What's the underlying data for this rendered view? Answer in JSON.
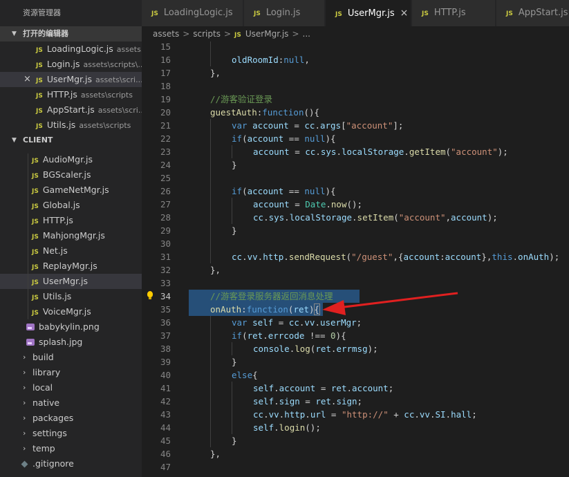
{
  "sidebar": {
    "title": "资源管理器",
    "open_editors_header": "打开的编辑器",
    "open_editors": [
      {
        "name": "LoadingLogic.js",
        "path": "assets..."
      },
      {
        "name": "Login.js",
        "path": "assets\\scripts\\..."
      },
      {
        "name": "UserMgr.js",
        "path": "assets\\scri...",
        "active": true
      },
      {
        "name": "HTTP.js",
        "path": "assets\\scripts"
      },
      {
        "name": "AppStart.js",
        "path": "assets\\scri..."
      },
      {
        "name": "Utils.js",
        "path": "assets\\scripts"
      }
    ],
    "client_header": "CLIENT",
    "client_files": [
      "AudioMgr.js",
      "BGScaler.js",
      "GameNetMgr.js",
      "Global.js",
      "HTTP.js",
      "MahjongMgr.js",
      "Net.js",
      "ReplayMgr.js",
      "UserMgr.js",
      "Utils.js",
      "VoiceMgr.js"
    ],
    "images": [
      "babykylin.png",
      "splash.jpg"
    ],
    "folders": [
      "build",
      "library",
      "local",
      "native",
      "packages",
      "settings",
      "temp"
    ],
    "dotfile": ".gitignore"
  },
  "tabs": [
    {
      "label": "LoadingLogic.js"
    },
    {
      "label": "Login.js"
    },
    {
      "label": "UserMgr.js",
      "active": true
    },
    {
      "label": "HTTP.js"
    },
    {
      "label": "AppStart.js"
    }
  ],
  "js_badge": "JS",
  "close_glyph": "×",
  "breadcrumb": {
    "parts": [
      "assets",
      "scripts",
      "UserMgr.js",
      "..."
    ],
    "separator": ">"
  },
  "editor": {
    "current_line": 34,
    "highlight_lines": [
      34,
      35
    ],
    "lines": [
      {
        "n": 15,
        "indent": 2,
        "tokens": []
      },
      {
        "n": 16,
        "indent": 2,
        "tokens": [
          [
            "v",
            "oldRoomId"
          ],
          [
            "p",
            ":"
          ],
          [
            "k",
            "null"
          ],
          [
            "p",
            ","
          ]
        ]
      },
      {
        "n": 17,
        "indent": 1,
        "tokens": [
          [
            "p",
            "},"
          ]
        ]
      },
      {
        "n": 18,
        "indent": 1,
        "tokens": []
      },
      {
        "n": 19,
        "indent": 1,
        "tokens": [
          [
            "c",
            "//游客验证登录"
          ]
        ]
      },
      {
        "n": 20,
        "indent": 1,
        "tokens": [
          [
            "f",
            "guestAuth"
          ],
          [
            "p",
            ":"
          ],
          [
            "k",
            "function"
          ],
          [
            "p",
            "(){"
          ]
        ]
      },
      {
        "n": 21,
        "indent": 2,
        "tokens": [
          [
            "k",
            "var"
          ],
          [
            "p",
            " "
          ],
          [
            "v",
            "account"
          ],
          [
            "p",
            " = "
          ],
          [
            "v",
            "cc"
          ],
          [
            "p",
            "."
          ],
          [
            "v",
            "args"
          ],
          [
            "p",
            "["
          ],
          [
            "s",
            "\"account\""
          ],
          [
            "p",
            "];"
          ]
        ]
      },
      {
        "n": 22,
        "indent": 2,
        "tokens": [
          [
            "k",
            "if"
          ],
          [
            "p",
            "("
          ],
          [
            "v",
            "account"
          ],
          [
            "p",
            " == "
          ],
          [
            "k",
            "null"
          ],
          [
            "p",
            "){"
          ]
        ]
      },
      {
        "n": 23,
        "indent": 3,
        "tokens": [
          [
            "v",
            "account"
          ],
          [
            "p",
            " = "
          ],
          [
            "v",
            "cc"
          ],
          [
            "p",
            "."
          ],
          [
            "v",
            "sys"
          ],
          [
            "p",
            "."
          ],
          [
            "v",
            "localStorage"
          ],
          [
            "p",
            "."
          ],
          [
            "f",
            "getItem"
          ],
          [
            "p",
            "("
          ],
          [
            "s",
            "\"account\""
          ],
          [
            "p",
            ");"
          ]
        ]
      },
      {
        "n": 24,
        "indent": 2,
        "tokens": [
          [
            "p",
            "}"
          ]
        ]
      },
      {
        "n": 25,
        "indent": 2,
        "tokens": []
      },
      {
        "n": 26,
        "indent": 2,
        "tokens": [
          [
            "k",
            "if"
          ],
          [
            "p",
            "("
          ],
          [
            "v",
            "account"
          ],
          [
            "p",
            " == "
          ],
          [
            "k",
            "null"
          ],
          [
            "p",
            "){"
          ]
        ]
      },
      {
        "n": 27,
        "indent": 3,
        "tokens": [
          [
            "v",
            "account"
          ],
          [
            "p",
            " = "
          ],
          [
            "t",
            "Date"
          ],
          [
            "p",
            "."
          ],
          [
            "f",
            "now"
          ],
          [
            "p",
            "();"
          ]
        ]
      },
      {
        "n": 28,
        "indent": 3,
        "tokens": [
          [
            "v",
            "cc"
          ],
          [
            "p",
            "."
          ],
          [
            "v",
            "sys"
          ],
          [
            "p",
            "."
          ],
          [
            "v",
            "localStorage"
          ],
          [
            "p",
            "."
          ],
          [
            "f",
            "setItem"
          ],
          [
            "p",
            "("
          ],
          [
            "s",
            "\"account\""
          ],
          [
            "p",
            ","
          ],
          [
            "v",
            "account"
          ],
          [
            "p",
            ");"
          ]
        ]
      },
      {
        "n": 29,
        "indent": 2,
        "tokens": [
          [
            "p",
            "}"
          ]
        ]
      },
      {
        "n": 30,
        "indent": 2,
        "tokens": []
      },
      {
        "n": 31,
        "indent": 2,
        "tokens": [
          [
            "v",
            "cc"
          ],
          [
            "p",
            "."
          ],
          [
            "v",
            "vv"
          ],
          [
            "p",
            "."
          ],
          [
            "v",
            "http"
          ],
          [
            "p",
            "."
          ],
          [
            "f",
            "sendRequest"
          ],
          [
            "p",
            "("
          ],
          [
            "s",
            "\"/guest\""
          ],
          [
            "p",
            ",{"
          ],
          [
            "v",
            "account"
          ],
          [
            "p",
            ":"
          ],
          [
            "v",
            "account"
          ],
          [
            "p",
            "},"
          ],
          [
            "k",
            "this"
          ],
          [
            "p",
            "."
          ],
          [
            "v",
            "onAuth"
          ],
          [
            "p",
            ");"
          ]
        ]
      },
      {
        "n": 32,
        "indent": 1,
        "tokens": [
          [
            "p",
            "},"
          ]
        ]
      },
      {
        "n": 33,
        "indent": 1,
        "tokens": []
      },
      {
        "n": 34,
        "indent": 1,
        "tokens": [
          [
            "c",
            "//游客登录服务器返回消息处理"
          ]
        ]
      },
      {
        "n": 35,
        "indent": 1,
        "tokens": [
          [
            "f",
            "onAuth"
          ],
          [
            "p",
            ":"
          ],
          [
            "k",
            "function"
          ],
          [
            "p",
            "("
          ],
          [
            "v",
            "ret"
          ],
          [
            "p",
            ")"
          ],
          [
            "p",
            "{"
          ]
        ]
      },
      {
        "n": 36,
        "indent": 2,
        "tokens": [
          [
            "k",
            "var"
          ],
          [
            "p",
            " "
          ],
          [
            "v",
            "self"
          ],
          [
            "p",
            " = "
          ],
          [
            "v",
            "cc"
          ],
          [
            "p",
            "."
          ],
          [
            "v",
            "vv"
          ],
          [
            "p",
            "."
          ],
          [
            "v",
            "userMgr"
          ],
          [
            "p",
            ";"
          ]
        ]
      },
      {
        "n": 37,
        "indent": 2,
        "tokens": [
          [
            "k",
            "if"
          ],
          [
            "p",
            "("
          ],
          [
            "v",
            "ret"
          ],
          [
            "p",
            "."
          ],
          [
            "v",
            "errcode"
          ],
          [
            "p",
            " !== "
          ],
          [
            "n",
            "0"
          ],
          [
            "p",
            "){"
          ]
        ]
      },
      {
        "n": 38,
        "indent": 3,
        "tokens": [
          [
            "v",
            "console"
          ],
          [
            "p",
            "."
          ],
          [
            "f",
            "log"
          ],
          [
            "p",
            "("
          ],
          [
            "v",
            "ret"
          ],
          [
            "p",
            "."
          ],
          [
            "v",
            "errmsg"
          ],
          [
            "p",
            ");"
          ]
        ]
      },
      {
        "n": 39,
        "indent": 2,
        "tokens": [
          [
            "p",
            "}"
          ]
        ]
      },
      {
        "n": 40,
        "indent": 2,
        "tokens": [
          [
            "k",
            "else"
          ],
          [
            "p",
            "{"
          ]
        ]
      },
      {
        "n": 41,
        "indent": 3,
        "tokens": [
          [
            "v",
            "self"
          ],
          [
            "p",
            "."
          ],
          [
            "v",
            "account"
          ],
          [
            "p",
            " = "
          ],
          [
            "v",
            "ret"
          ],
          [
            "p",
            "."
          ],
          [
            "v",
            "account"
          ],
          [
            "p",
            ";"
          ]
        ]
      },
      {
        "n": 42,
        "indent": 3,
        "tokens": [
          [
            "v",
            "self"
          ],
          [
            "p",
            "."
          ],
          [
            "v",
            "sign"
          ],
          [
            "p",
            " = "
          ],
          [
            "v",
            "ret"
          ],
          [
            "p",
            "."
          ],
          [
            "v",
            "sign"
          ],
          [
            "p",
            ";"
          ]
        ]
      },
      {
        "n": 43,
        "indent": 3,
        "tokens": [
          [
            "v",
            "cc"
          ],
          [
            "p",
            "."
          ],
          [
            "v",
            "vv"
          ],
          [
            "p",
            "."
          ],
          [
            "v",
            "http"
          ],
          [
            "p",
            "."
          ],
          [
            "v",
            "url"
          ],
          [
            "p",
            " = "
          ],
          [
            "s",
            "\"http://\""
          ],
          [
            "p",
            " + "
          ],
          [
            "v",
            "cc"
          ],
          [
            "p",
            "."
          ],
          [
            "v",
            "vv"
          ],
          [
            "p",
            "."
          ],
          [
            "v",
            "SI"
          ],
          [
            "p",
            "."
          ],
          [
            "v",
            "hall"
          ],
          [
            "p",
            ";"
          ]
        ]
      },
      {
        "n": 44,
        "indent": 3,
        "tokens": [
          [
            "v",
            "self"
          ],
          [
            "p",
            "."
          ],
          [
            "f",
            "login"
          ],
          [
            "p",
            "();"
          ]
        ]
      },
      {
        "n": 45,
        "indent": 2,
        "tokens": [
          [
            "p",
            "}"
          ]
        ]
      },
      {
        "n": 46,
        "indent": 1,
        "tokens": [
          [
            "p",
            "},"
          ]
        ]
      },
      {
        "n": 47,
        "indent": 1,
        "tokens": []
      }
    ]
  },
  "colors": {
    "keyword": "#569cd6",
    "function": "#dcdcaa",
    "variable": "#9cdcfe",
    "string": "#ce9178",
    "comment": "#6a9955",
    "selection": "#264f78",
    "annotation_arrow": "#e02020"
  },
  "icons": {
    "lightbulb": "lightbulb-icon",
    "chevron_down": "chevron-down-icon",
    "chevron_right": "chevron-right-icon",
    "close": "close-icon"
  }
}
